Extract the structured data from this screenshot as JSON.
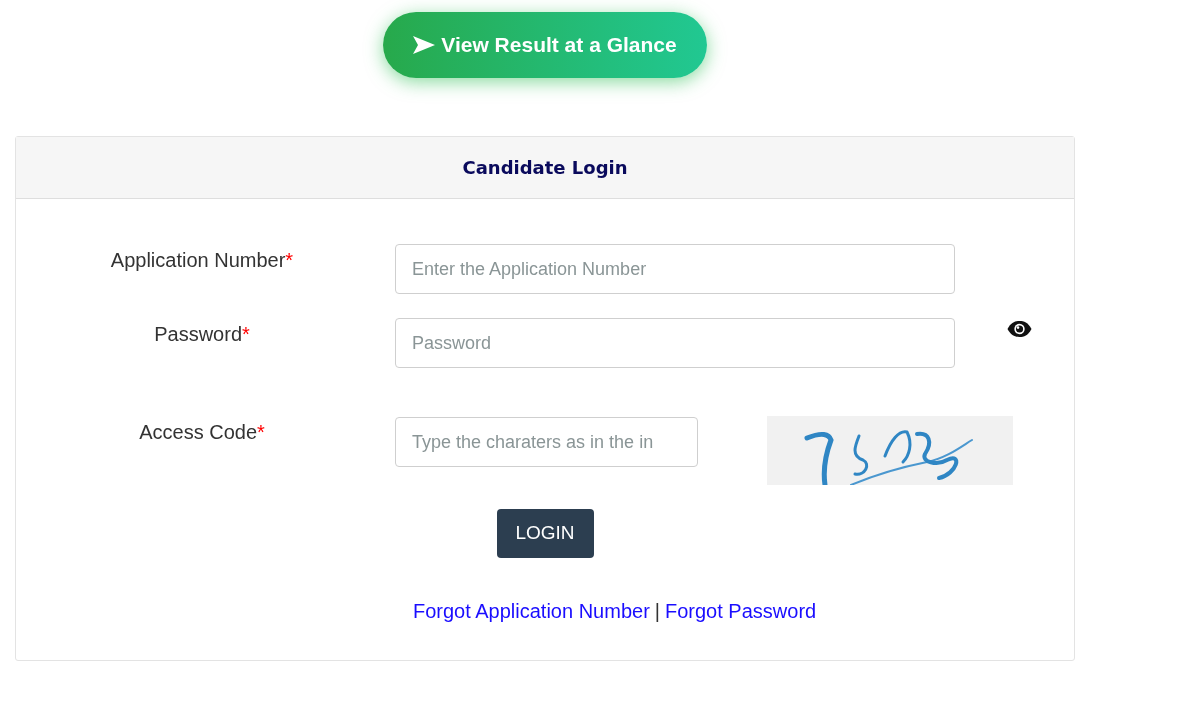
{
  "glance_button": {
    "label": "View Result at a Glance"
  },
  "login_card": {
    "title": "Candidate Login",
    "fields": [
      {
        "kind": "text",
        "label": "Application Number",
        "required_mark": "*",
        "placeholder": "Enter the Application Number"
      },
      {
        "kind": "password",
        "label": "Password",
        "required_mark": "*",
        "placeholder": "Password"
      },
      {
        "kind": "captcha",
        "label": "Access Code",
        "required_mark": "*",
        "placeholder": "Type the charaters as in the in"
      }
    ],
    "login_button": {
      "label": "LOGIN"
    },
    "links": [
      {
        "label": "Forgot Application Number"
      },
      {
        "label": "Forgot Password"
      }
    ],
    "link_separator": "|"
  }
}
